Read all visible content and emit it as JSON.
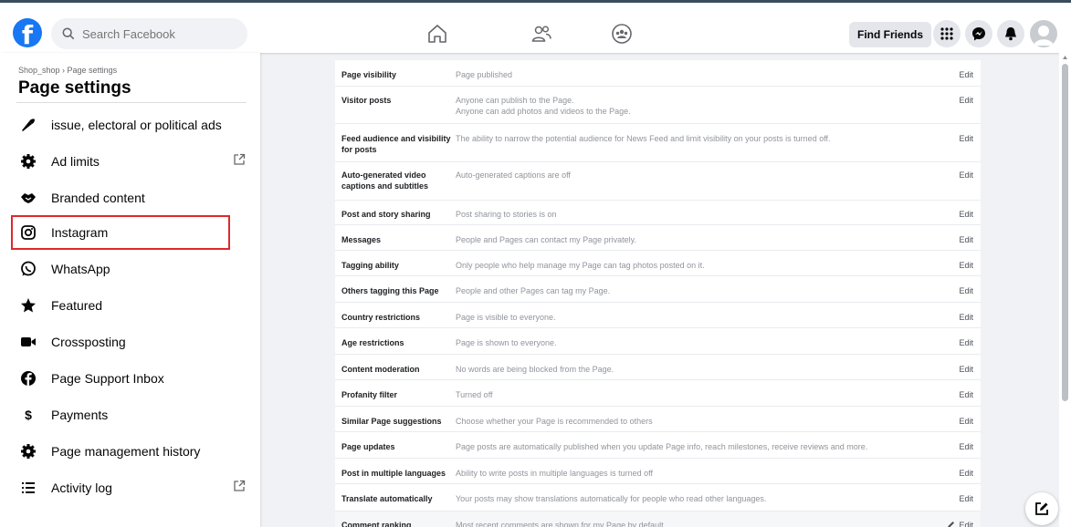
{
  "search": {
    "placeholder": "Search Facebook"
  },
  "header": {
    "logo_letter": "f",
    "find_friends_label": "Find Friends",
    "brand_color": "#1877f2"
  },
  "sidebar": {
    "breadcrumb": "Shop_shop › Page settings",
    "title": "Page settings",
    "items": [
      {
        "label": "issue, electoral or political ads",
        "icon": "megaphone-icon"
      },
      {
        "label": "Ad limits",
        "icon": "gear-icon",
        "external": true
      },
      {
        "label": "Branded content",
        "icon": "handshake-icon"
      },
      {
        "label": "Instagram",
        "icon": "instagram-icon",
        "highlighted": true
      },
      {
        "label": "WhatsApp",
        "icon": "whatsapp-icon"
      },
      {
        "label": "Featured",
        "icon": "star-icon"
      },
      {
        "label": "Crossposting",
        "icon": "video-icon"
      },
      {
        "label": "Page Support Inbox",
        "icon": "facebook-icon"
      },
      {
        "label": "Payments",
        "icon": "dollar-icon",
        "glyph": "$"
      },
      {
        "label": "Page management history",
        "icon": "gear-icon"
      },
      {
        "label": "Activity log",
        "icon": "list-icon",
        "external": true
      }
    ]
  },
  "settings": {
    "edit_label": "Edit",
    "rows": [
      {
        "name": "Page visibility",
        "desc": "Page published"
      },
      {
        "name": "Visitor posts",
        "desc": "Anyone can publish to the Page.",
        "desc2": "Anyone can add photos and videos to the Page."
      },
      {
        "name": "Feed audience and visibility for posts",
        "desc": "The ability to narrow the potential audience for News Feed and limit visibility on your posts is turned off."
      },
      {
        "name": "Auto-generated video captions and subtitles",
        "desc": "Auto-generated captions are off"
      },
      {
        "name": "Post and story sharing",
        "desc": "Post sharing to stories is on"
      },
      {
        "name": "Messages",
        "desc": "People and Pages can contact my Page privately."
      },
      {
        "name": "Tagging ability",
        "desc": "Only people who help manage my Page can tag photos posted on it."
      },
      {
        "name": "Others tagging this Page",
        "desc": "People and other Pages can tag my Page."
      },
      {
        "name": "Country restrictions",
        "desc": "Page is visible to everyone."
      },
      {
        "name": "Age restrictions",
        "desc": "Page is shown to everyone."
      },
      {
        "name": "Content moderation",
        "desc": "No words are being blocked from the Page."
      },
      {
        "name": "Profanity filter",
        "desc": "Turned off"
      },
      {
        "name": "Similar Page suggestions",
        "desc": "Choose whether your Page is recommended to others"
      },
      {
        "name": "Page updates",
        "desc": "Page posts are automatically published when you update Page info, reach milestones, receive reviews and more."
      },
      {
        "name": "Post in multiple languages",
        "desc": "Ability to write posts in multiple languages is turned off"
      },
      {
        "name": "Translate automatically",
        "desc": "Your posts may show translations automatically for people who read other languages."
      },
      {
        "name": "Comment ranking",
        "desc": "Most recent comments are shown for my Page by default."
      }
    ]
  }
}
